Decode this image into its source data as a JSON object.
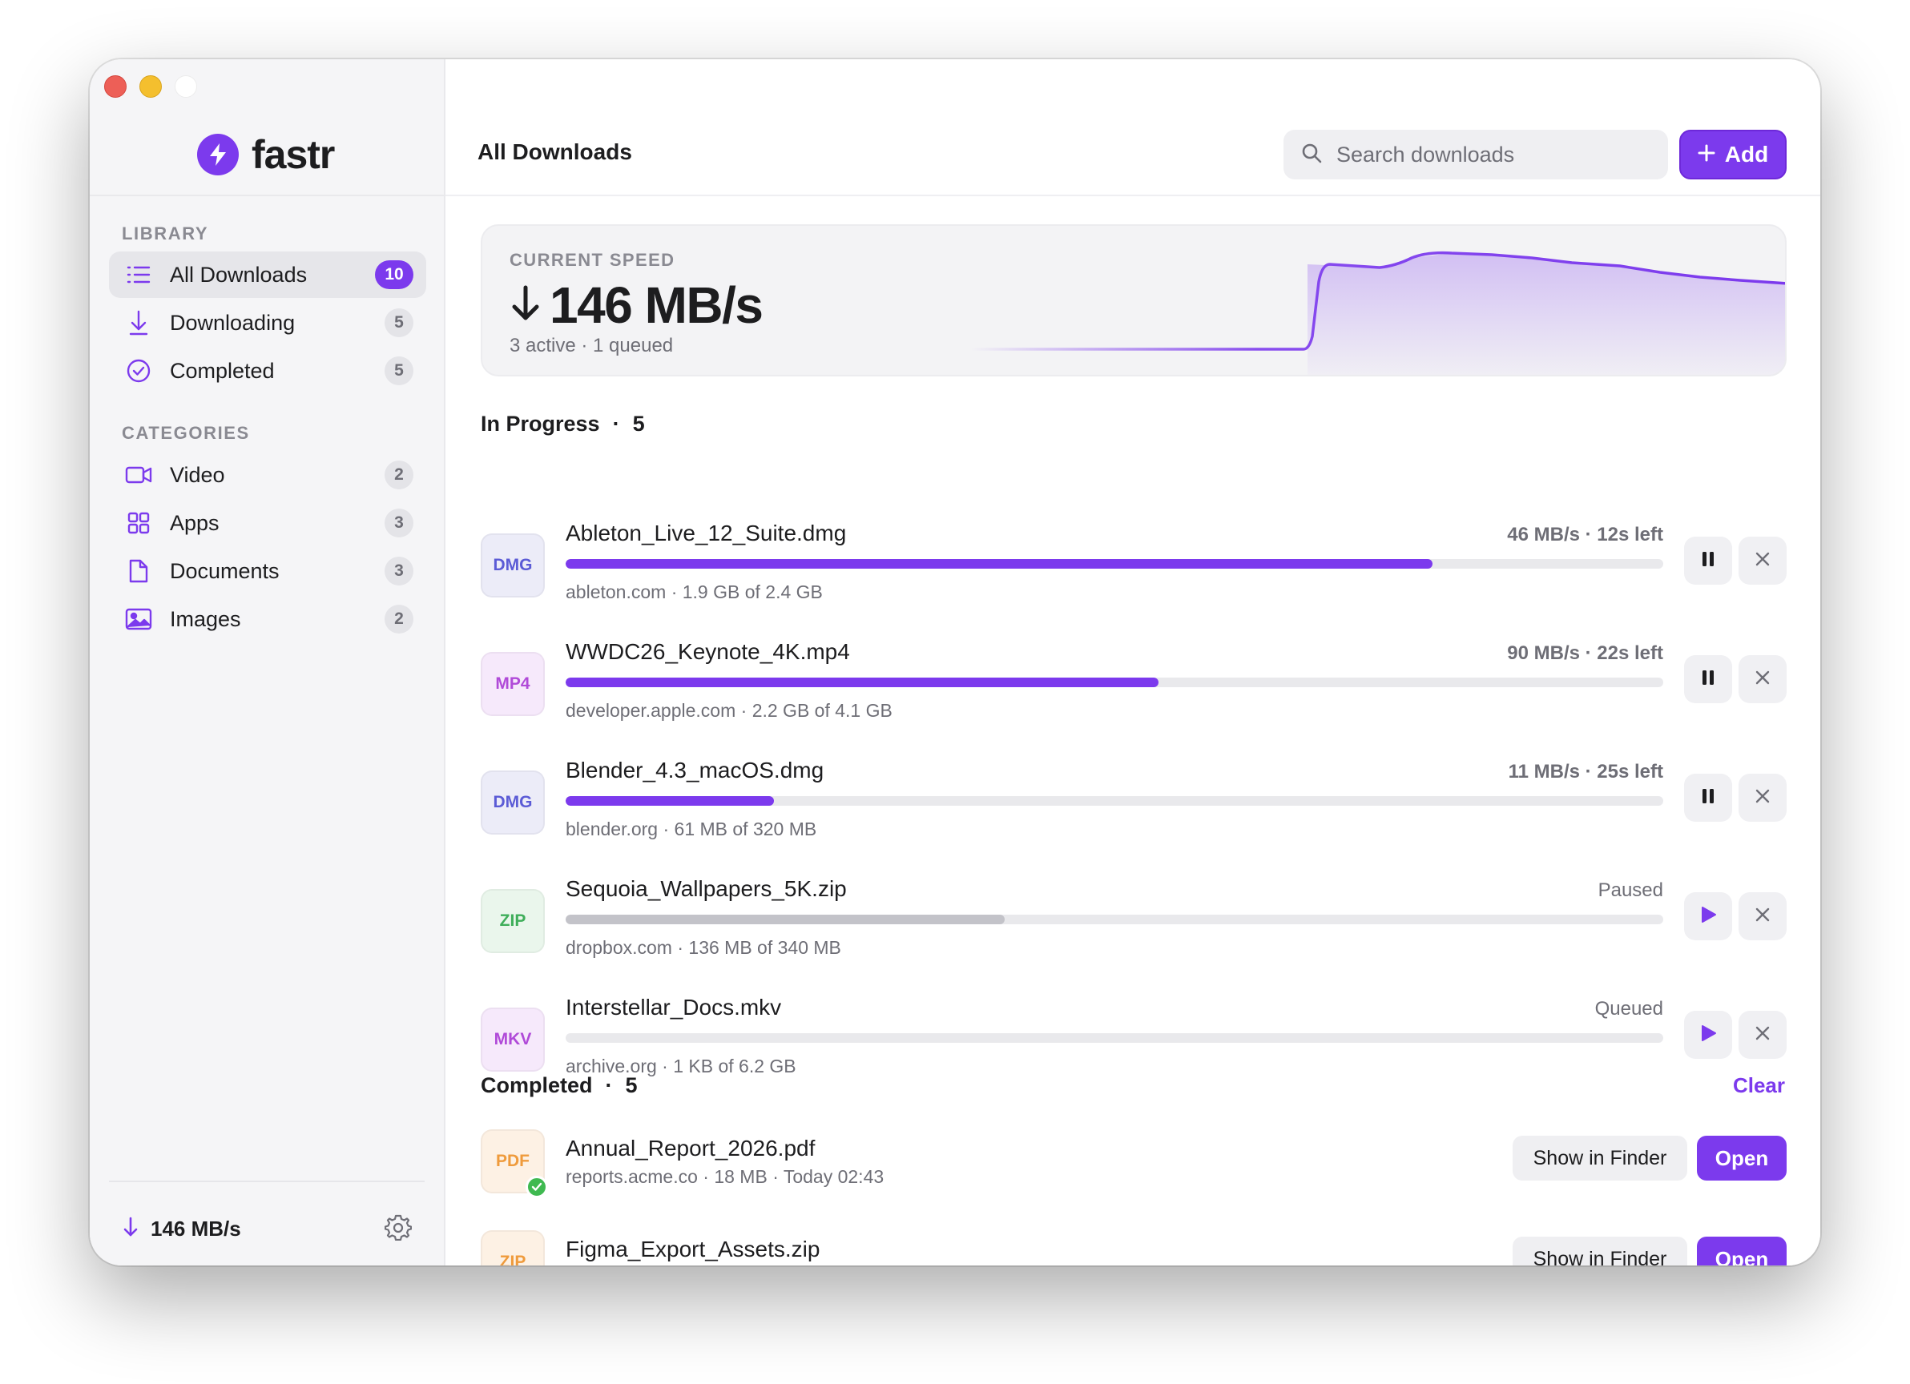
{
  "app": {
    "name": "fastr",
    "accent": "#7c3aed"
  },
  "sidebar": {
    "library_label": "LIBRARY",
    "library": [
      {
        "label": "All Downloads",
        "count": "10",
        "icon": "list-icon",
        "active": true
      },
      {
        "label": "Downloading",
        "count": "5",
        "icon": "arrow-down-icon",
        "active": false
      },
      {
        "label": "Completed",
        "count": "5",
        "icon": "check-circle-icon",
        "active": false
      }
    ],
    "categories_label": "CATEGORIES",
    "categories": [
      {
        "label": "Video",
        "count": "2",
        "icon": "video-camera-icon"
      },
      {
        "label": "Apps",
        "count": "3",
        "icon": "grid-icon"
      },
      {
        "label": "Documents",
        "count": "3",
        "icon": "document-icon"
      },
      {
        "label": "Images",
        "count": "2",
        "icon": "image-icon"
      }
    ],
    "footer_speed": "146 MB/s"
  },
  "header": {
    "title": "All Downloads",
    "search_placeholder": "Search downloads",
    "add_label": "Add"
  },
  "speed": {
    "label": "CURRENT SPEED",
    "value": "146 MB/s",
    "sub": "3 active · 1 queued"
  },
  "in_progress": {
    "title": "In Progress",
    "count": "5",
    "items": [
      {
        "type": "DMG",
        "name": "Ableton_Live_12_Suite.dmg",
        "status": "46 MB/s · 12s left",
        "progress": 0.79,
        "sub": "ableton.com · 1.9 GB of 2.4 GB",
        "state": "active",
        "badge_bg": "#ececf8",
        "badge_fg": "#5b5bd6"
      },
      {
        "type": "MP4",
        "name": "WWDC26_Keynote_4K.mp4",
        "status": "90 MB/s · 22s left",
        "progress": 0.54,
        "sub": "developer.apple.com · 2.2 GB of 4.1 GB",
        "state": "active",
        "badge_bg": "#f6e9fb",
        "badge_fg": "#b04ad8"
      },
      {
        "type": "DMG",
        "name": "Blender_4.3_macOS.dmg",
        "status": "11 MB/s · 25s left",
        "progress": 0.19,
        "sub": "blender.org · 61 MB of 320 MB",
        "state": "active",
        "badge_bg": "#ececf8",
        "badge_fg": "#5b5bd6"
      },
      {
        "type": "ZIP",
        "name": "Sequoia_Wallpapers_5K.zip",
        "status": "Paused",
        "progress": 0.4,
        "sub": "dropbox.com · 136 MB of 340 MB",
        "state": "paused",
        "badge_bg": "#eaf6ec",
        "badge_fg": "#3fae5a"
      },
      {
        "type": "MKV",
        "name": "Interstellar_Docs.mkv",
        "status": "Queued",
        "progress": 0.0,
        "sub": "archive.org · 1 KB of 6.2 GB",
        "state": "queued",
        "badge_bg": "#f6e9fb",
        "badge_fg": "#b04ad8"
      }
    ]
  },
  "completed": {
    "title": "Completed",
    "count": "5",
    "clear_label": "Clear",
    "items": [
      {
        "type": "PDF",
        "name": "Annual_Report_2026.pdf",
        "sub": "reports.acme.co · 18 MB · Today 02:43",
        "finder_label": "Show in Finder",
        "open_label": "Open",
        "badge_bg": "#fdf1e4",
        "badge_fg": "#ef9b3c"
      },
      {
        "type": "ZIP",
        "name": "Figma_Export_Assets.zip",
        "sub": "",
        "finder_label": "Show in Finder",
        "open_label": "Open",
        "badge_bg": "#fdf1e4",
        "badge_fg": "#ef9b3c"
      }
    ]
  }
}
